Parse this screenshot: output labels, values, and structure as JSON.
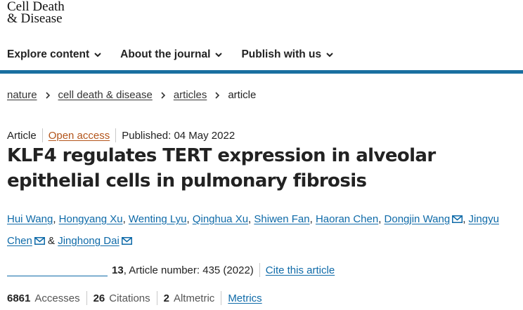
{
  "logo": {
    "line1": "Cell Death",
    "line2": "& Disease"
  },
  "nav": {
    "items": [
      {
        "label": "Explore content"
      },
      {
        "label": "About the journal"
      },
      {
        "label": "Publish with us"
      }
    ]
  },
  "breadcrumb": {
    "items": [
      "nature",
      "cell death & disease",
      "articles"
    ],
    "current": "article"
  },
  "meta": {
    "type": "Article",
    "access": "Open access",
    "published": "Published: 04 May 2022"
  },
  "title": "KLF4 regulates TERT expression in alveolar epithelial cells in pulmonary fibrosis",
  "authors": {
    "names": [
      "Hui Wang",
      "Hongyang Xu",
      "Wenting Lyu",
      "Qinghua Xu",
      "Shiwen Fan",
      "Haoran Chen",
      "Dongjin Wang",
      "Jingyu Chen",
      "Jinghong Dai"
    ],
    "ampersand": "&"
  },
  "volume": {
    "number": "13",
    "article_number": ", Article number: 435 (2022)",
    "cite": "Cite this article"
  },
  "metrics": {
    "accesses_value": "6861",
    "accesses_label": "Accesses",
    "citations_value": "26",
    "citations_label": "Citations",
    "altmetric_value": "2",
    "altmetric_label": "Altmetric",
    "metrics_link": "Metrics"
  },
  "colors": {
    "accent_rule": "#1a6fa0",
    "link": "#0e6aa8",
    "open_access": "#b3551b"
  }
}
